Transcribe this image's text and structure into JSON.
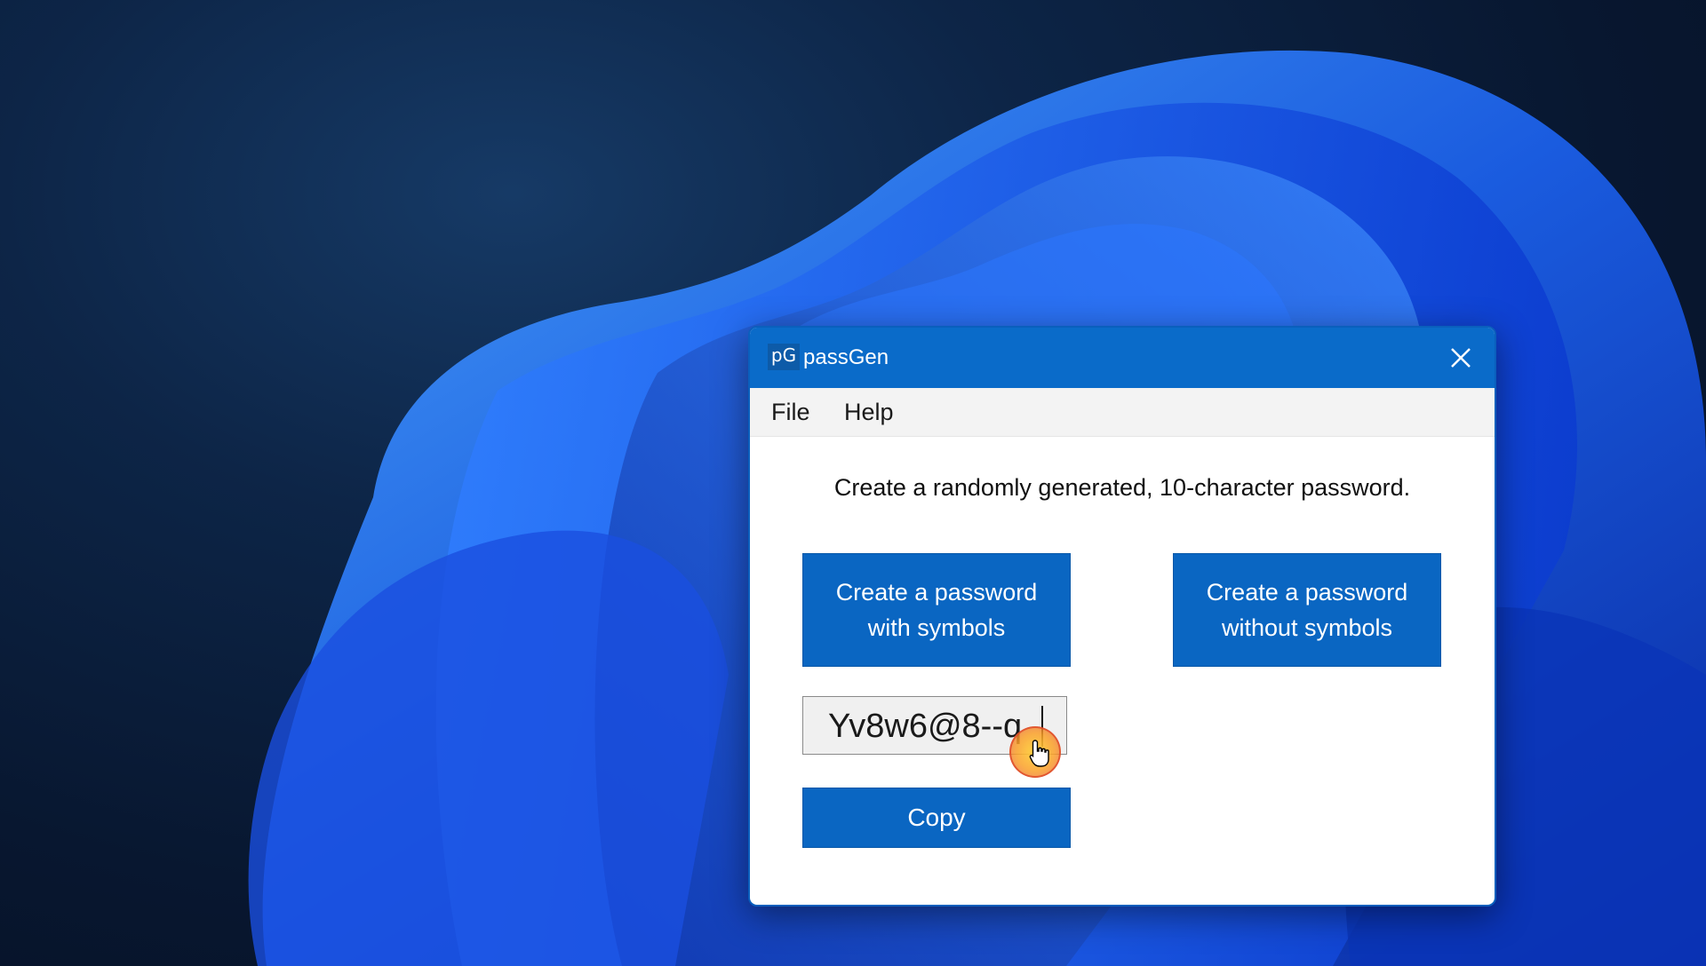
{
  "window": {
    "icon_text": "pG",
    "title": "passGen"
  },
  "menu": {
    "file": "File",
    "help": "Help"
  },
  "main": {
    "description": "Create a randomly generated, 10-character password.",
    "btn_with_symbols": "Create a password with symbols",
    "btn_without_symbols": "Create a password without symbols",
    "password_value": "Yv8w6@8--q",
    "copy_label": "Copy"
  },
  "colors": {
    "accent": "#0a66c2",
    "titlebar": "#0a6bc9"
  },
  "icons": {
    "close": "close-icon",
    "cursor": "hand-pointer-icon"
  }
}
